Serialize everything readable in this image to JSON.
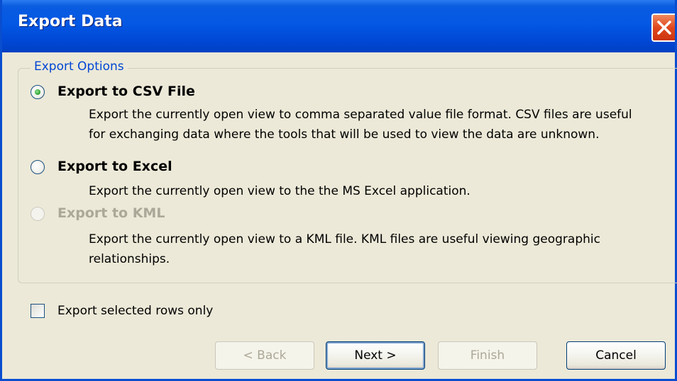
{
  "window": {
    "title": "Export Data"
  },
  "group": {
    "legend": "Export Options"
  },
  "options": [
    {
      "label": "Export to CSV File",
      "description_line1": "Export the currently open view to comma separated value file format. CSV files are useful",
      "description_line2": "for exchanging data where the tools that will be used to view the data are unknown.",
      "selected": true,
      "enabled": true
    },
    {
      "label": "Export to Excel",
      "description_line1": "Export the currently open view to the the MS Excel application.",
      "selected": false,
      "enabled": true
    },
    {
      "label": "Export to KML",
      "description_line1": "Export the currently open view to a KML file. KML files are useful viewing geographic",
      "description_line2": "relationships.",
      "selected": false,
      "enabled": false
    }
  ],
  "checkbox": {
    "label": "Export selected rows only",
    "checked": false
  },
  "buttons": {
    "back": "< Back",
    "next": "Next >",
    "finish": "Finish",
    "cancel": "Cancel"
  },
  "colors": {
    "titlebar": "#0358e4",
    "legend_text": "#0046d5",
    "dialog_bg": "#ece9d8",
    "disabled_text": "#aca899"
  }
}
